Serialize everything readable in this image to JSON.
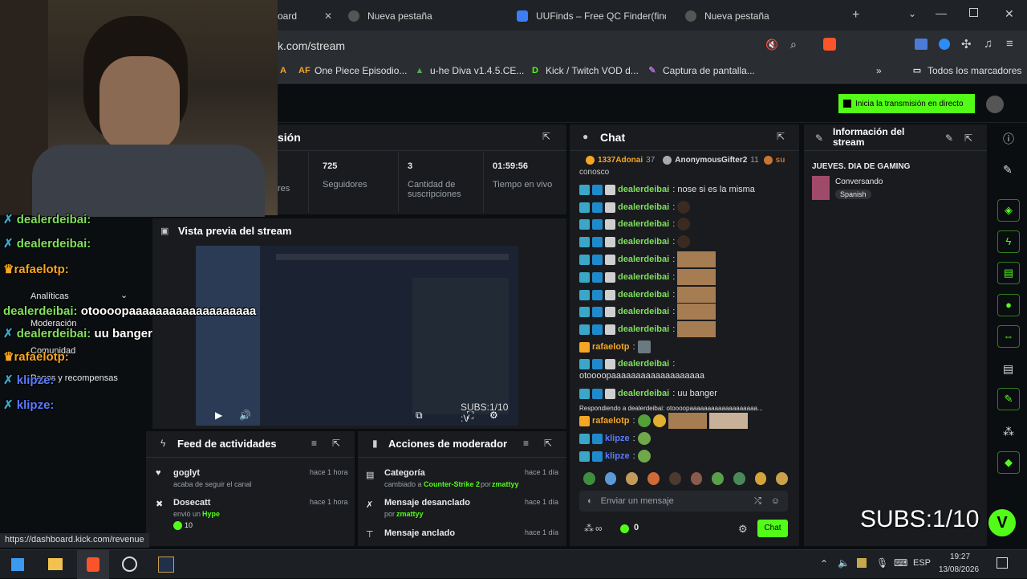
{
  "browser": {
    "tabs": [
      {
        "label": "oard",
        "active": true
      },
      {
        "label": "Nueva pestaña"
      },
      {
        "label": "UUFinds – Free QC Finder(findqc"
      },
      {
        "label": "Nueva pestaña"
      }
    ],
    "address": "k.com/stream",
    "bookmarks": [
      "One Piece Episodio...",
      "u-he Diva v1.4.5.CE...",
      "Kick / Twitch VOD d...",
      "Captura de pantalla..."
    ],
    "bookmarks_folder": "Todos los marcadores",
    "status_url": "https://dashboard.kick.com/revenue"
  },
  "header": {
    "go_live_button": "Inicia la transmisión en directo"
  },
  "session": {
    "title": "sión",
    "stats": [
      {
        "value": "",
        "label": "res"
      },
      {
        "value": "725",
        "label": "Seguidores"
      },
      {
        "value": "3",
        "label": "Cantidad de suscripciones"
      },
      {
        "value": "01:59:56",
        "label": "Tiempo en vivo"
      }
    ]
  },
  "preview": {
    "title": "Vista previa del stream",
    "subs_overlay": "SUBS:1/10 :V"
  },
  "sidebar_menu": [
    "Analíticas",
    "Moderación",
    "Comunidad",
    "Pagos y recompensas"
  ],
  "activity_feed": {
    "title": "Feed de actividades",
    "items": [
      {
        "name": "goglyt",
        "desc": "acaba de seguir el canal",
        "time": "hace 1 hora"
      },
      {
        "name": "Dosecatt",
        "desc": "envió un",
        "extra": "Hype",
        "amount": "10",
        "time": "hace 1 hora"
      }
    ]
  },
  "mod_actions": {
    "title": "Acciones de moderador",
    "items": [
      {
        "name": "Categoría",
        "desc": "cambiado a",
        "target": "Counter-Strike 2",
        "by": "por",
        "user": "zmattyy",
        "time": "hace 1 día"
      },
      {
        "name": "Mensaje desanclado",
        "desc": "",
        "target": "",
        "by": "por",
        "user": "zmattyy",
        "time": "hace 1 día"
      },
      {
        "name": "Mensaje anclado",
        "desc": "",
        "target": "",
        "by": "",
        "user": "",
        "time": "hace 1 día"
      }
    ]
  },
  "chat": {
    "title": "Chat",
    "gifters": [
      {
        "name": "1337Adonai",
        "count": "37"
      },
      {
        "name": "AnonymousGifter2",
        "count": "11"
      },
      {
        "name": "su",
        "count": ""
      }
    ],
    "top_fragment": "conosco",
    "messages": [
      {
        "user": "dealerdeibai",
        "text": "nose si es la misma"
      },
      {
        "user": "dealerdeibai",
        "text": ""
      },
      {
        "user": "dealerdeibai",
        "text": ""
      },
      {
        "user": "dealerdeibai",
        "text": ""
      },
      {
        "user": "dealerdeibai",
        "text": ""
      },
      {
        "user": "dealerdeibai",
        "text": ""
      },
      {
        "user": "dealerdeibai",
        "text": ""
      },
      {
        "user": "dealerdeibai",
        "text": ""
      },
      {
        "user": "dealerdeibai",
        "text": ""
      },
      {
        "user": "rafaelotp",
        "text": ""
      },
      {
        "user": "dealerdeibai",
        "text": "otoooopaaaaaaaaaaaaaaaaaaa"
      },
      {
        "user": "dealerdeibai",
        "text": "uu banger"
      },
      {
        "user": "rafaelotp",
        "text": ""
      },
      {
        "user": "klipze",
        "text": ""
      },
      {
        "user": "klipze",
        "text": ""
      }
    ],
    "reply_hint": "Respondiendo a dealerdeibai: otoooopaaaaaaaaaaaaaaaaaaa...",
    "input_placeholder": "Enviar un mensaje",
    "send_label": "Chat",
    "points": "0",
    "infinity": "∞"
  },
  "stream_info": {
    "title": "Información del stream",
    "stream_title": "JUEVES. DIA DE GAMING",
    "category": "Conversando",
    "language": "Spanish"
  },
  "overlay": {
    "subs": "SUBS:1/10",
    "lines": [
      {
        "user": "dealerdeibai:",
        "text": ""
      },
      {
        "user": "dealerdeibai:",
        "text": ""
      },
      {
        "user": "rafaelotp:",
        "text": ""
      },
      {
        "user": "",
        "text": ""
      },
      {
        "user": "dealerdeibai:",
        "text": "otoooopaaaaaaaaaaaaaaaaaaa"
      },
      {
        "user": "dealerdeibai:",
        "text": "uu banger"
      },
      {
        "user": "rafaelotp:",
        "text": ""
      },
      {
        "user": "klipze:",
        "text": ""
      },
      {
        "user": "klipze:",
        "text": ""
      }
    ]
  },
  "taskbar": {
    "lang": "ESP",
    "time": "19:27",
    "date": "13/08/2026"
  },
  "colors": {
    "accent": "#53fc18",
    "panel": "#191b1f",
    "bg": "#0b0e11"
  }
}
